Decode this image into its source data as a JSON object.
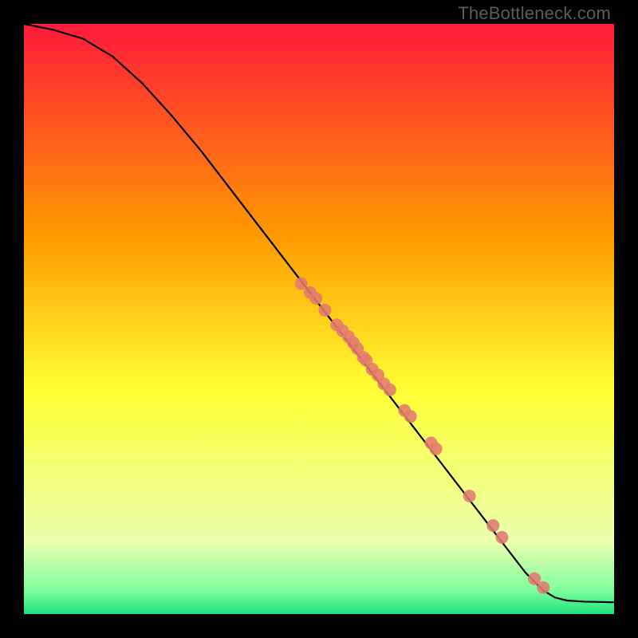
{
  "watermark": "TheBottleneck.com",
  "colors": {
    "background": "#000000",
    "curve": "#000000",
    "marker_fill": "#e2796f",
    "marker_stroke": "#c94f46",
    "watermark": "#5c5c5c",
    "gradient_top": "#ff1a3a",
    "gradient_mid1": "#ff9a00",
    "gradient_mid2": "#ffff33",
    "gradient_mid3": "#eaffb0",
    "gradient_bottom": "#1fe07a"
  },
  "chart_data": {
    "type": "line",
    "title": "",
    "xlabel": "",
    "ylabel": "",
    "xlim": [
      0,
      100
    ],
    "ylim": [
      0,
      100
    ],
    "curve": {
      "x": [
        0,
        5,
        10,
        15,
        20,
        25,
        30,
        35,
        40,
        45,
        50,
        55,
        60,
        65,
        70,
        75,
        80,
        85,
        88,
        90,
        92,
        95,
        100
      ],
      "y": [
        100,
        99,
        97.5,
        94.5,
        90,
        84.5,
        78.5,
        72,
        65.5,
        59,
        52.5,
        46,
        39.5,
        33,
        26.5,
        20,
        13.5,
        7,
        4,
        2.8,
        2.3,
        2.1,
        2.0
      ]
    },
    "series": [
      {
        "name": "data-points",
        "type": "scatter",
        "x": [
          47,
          48.5,
          49.5,
          51,
          53,
          54,
          55,
          55.8,
          56.5,
          57.5,
          58,
          59,
          60,
          61,
          62,
          64.5,
          65.5,
          69,
          69.8,
          75.5,
          79.5,
          81,
          86.5,
          88
        ],
        "y": [
          56,
          54.5,
          53.5,
          51.5,
          49,
          48,
          47,
          46,
          45,
          43.5,
          43,
          41.5,
          40.5,
          39,
          38,
          34.5,
          33.5,
          29,
          28,
          20,
          15,
          13,
          6,
          4.5
        ]
      }
    ]
  }
}
